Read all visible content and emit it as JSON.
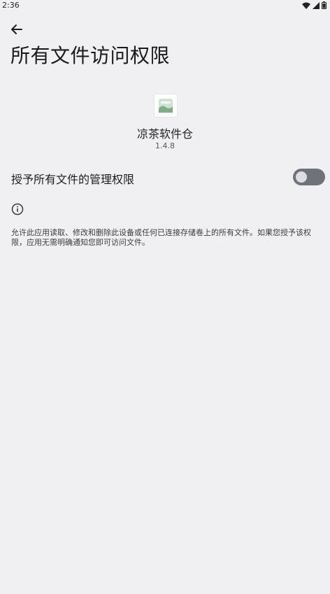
{
  "status_bar": {
    "time": "2:36"
  },
  "header": {
    "title": "所有文件访问权限"
  },
  "app": {
    "name": "凉茶软件仓",
    "version": "1.4.8"
  },
  "permission": {
    "label": "授予所有文件的管理权限",
    "enabled": false
  },
  "info": {
    "description": "允许此应用读取、修改和删除此设备或任何已连接存储卷上的所有文件。如果您授予该权限，应用无需明确通知您即可访问文件。"
  },
  "colors": {
    "background": "#f0f0f3",
    "toggle_track_off": "#6f7278",
    "toggle_knob_off": "#dcdde0"
  }
}
